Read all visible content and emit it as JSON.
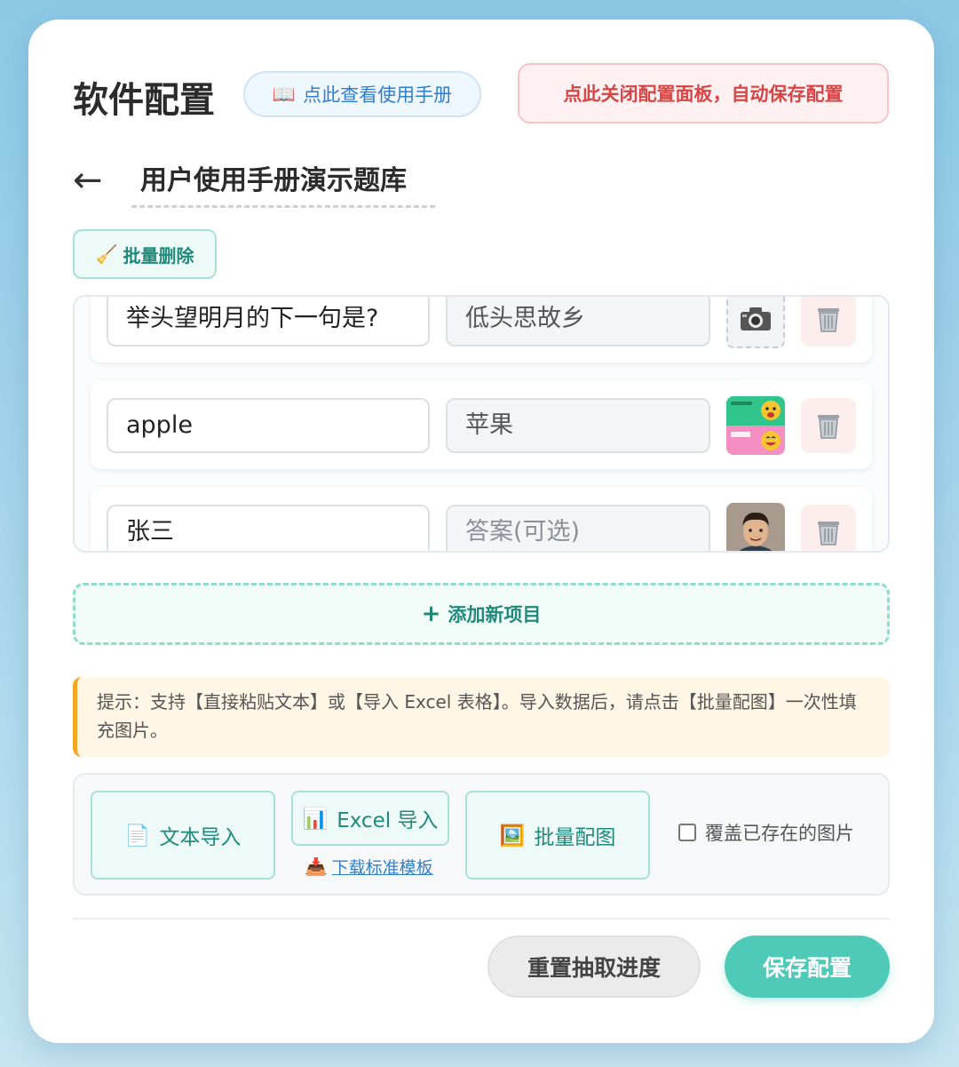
{
  "header": {
    "title": "软件配置",
    "manual_button": "点此查看使用手册",
    "close_button": "点此关闭配置面板，自动保存配置"
  },
  "bank": {
    "back_arrow": "←",
    "title": "用户使用手册演示题库"
  },
  "toolbar": {
    "batch_delete": "批量删除"
  },
  "items": [
    {
      "question": "举头望明月的下一句是?",
      "answer": "低头思故乡",
      "answer_placeholder": "",
      "image": "camera-placeholder"
    },
    {
      "question": "apple",
      "answer": "苹果",
      "answer_placeholder": "",
      "image": "sticker-image"
    },
    {
      "question": "张三",
      "answer": "",
      "answer_placeholder": "答案(可选)",
      "image": "avatar-image"
    }
  ],
  "add_button": "添加新项目",
  "tip": "提示：支持【直接粘贴文本】或【导入 Excel 表格】。导入数据后，请点击【批量配图】一次性填充图片。",
  "import": {
    "text_import": "文本导入",
    "excel_import": "Excel 导入",
    "download_template": "下载标准模板",
    "batch_image": "批量配图",
    "overwrite_label": "覆盖已存在的图片"
  },
  "footer": {
    "reset_button": "重置抽取进度",
    "save_button": "保存配置"
  },
  "colors": {
    "accent": "#4fcab8",
    "danger": "#d94545",
    "link": "#2f7fd0",
    "warning": "#f5a623"
  }
}
